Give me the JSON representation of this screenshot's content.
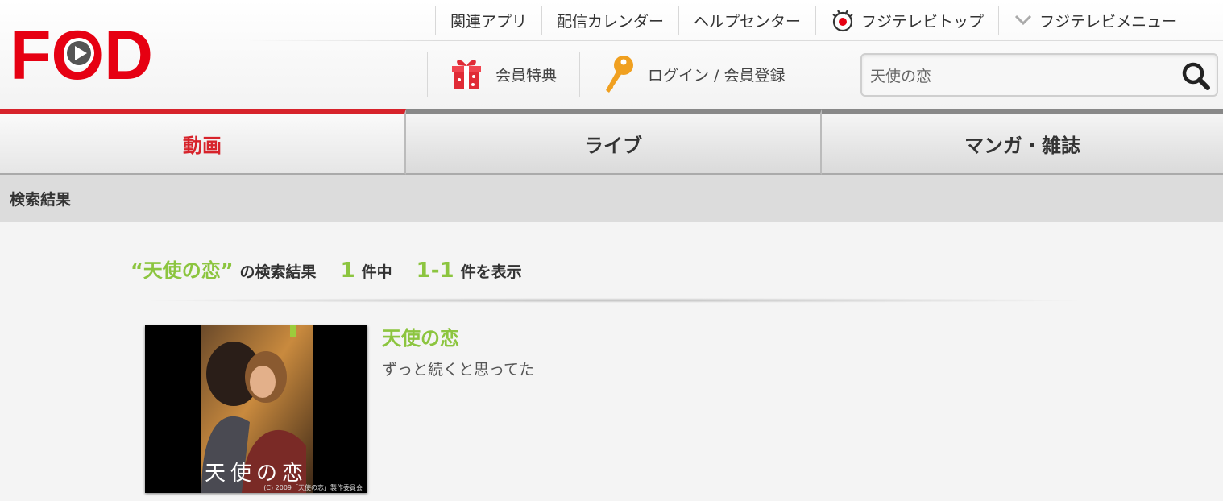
{
  "header": {
    "logo_text": "FOD",
    "top_links": [
      {
        "label": "関連アプリ"
      },
      {
        "label": "配信カレンダー"
      },
      {
        "label": "ヘルプセンター"
      },
      {
        "label": "フジテレビトップ",
        "icon": "fujitv-icon"
      },
      {
        "label": "フジテレビメニュー",
        "icon": "chevron-down-icon"
      }
    ],
    "member_benefit_label": "会員特典",
    "login_label": "ログイン / 会員登録",
    "search": {
      "value": "天使の恋"
    }
  },
  "tabs": [
    {
      "label": "動画",
      "active": true
    },
    {
      "label": "ライブ",
      "active": false
    },
    {
      "label": "マンガ・雑誌",
      "active": false
    }
  ],
  "breadcrumb": {
    "label": "検索結果"
  },
  "results_summary": {
    "query_display": "“天使の恋”",
    "results_label": "の検索結果",
    "total": "1",
    "total_suffix": "件中",
    "range": "1-1",
    "range_suffix": "件を表示"
  },
  "results": [
    {
      "title": "天使の恋",
      "description": "ずっと続くと思ってた",
      "thumb_title": "天使の恋",
      "thumb_credit": "(C) 2009「天使の恋」製作委員会"
    }
  ],
  "colors": {
    "brand_red": "#d7232b",
    "accent_green": "#8cc53f"
  }
}
